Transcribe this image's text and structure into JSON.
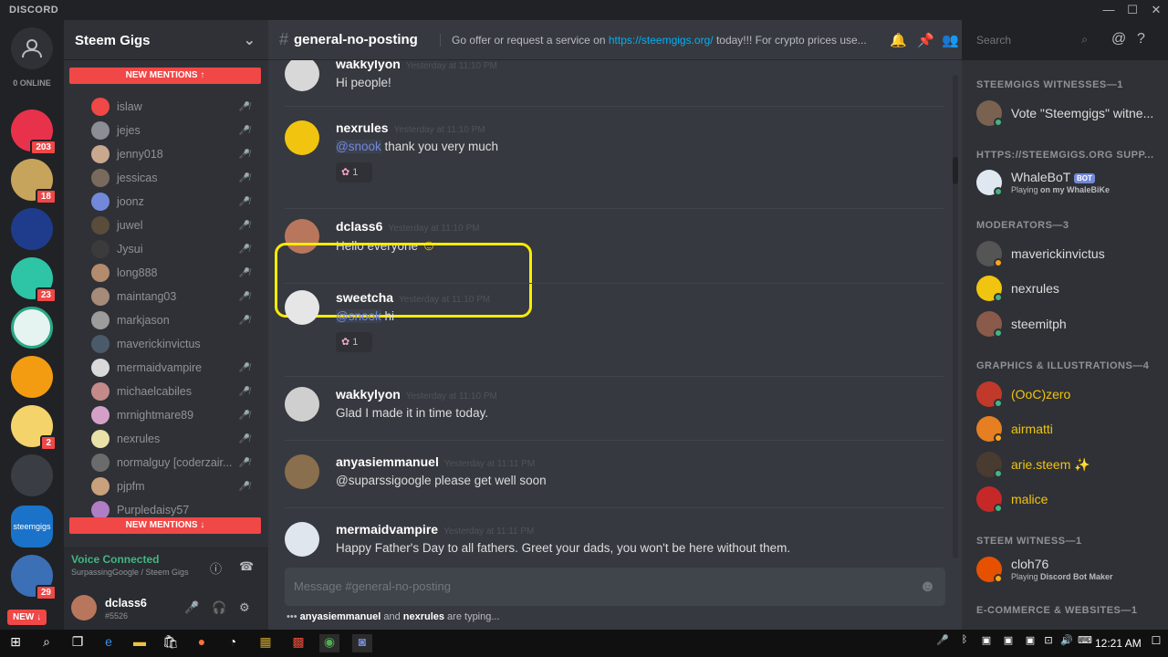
{
  "app": {
    "title": "DISCORD"
  },
  "guilds": {
    "online": "0 ONLINE",
    "items": [
      {
        "badge": "203"
      },
      {
        "badge": "18"
      },
      {
        "badge": ""
      },
      {
        "badge": "23"
      },
      {
        "badge": ""
      },
      {
        "badge": ""
      },
      {
        "badge": "2"
      },
      {
        "badge": ""
      },
      {
        "label": "steemgigs",
        "badge": ""
      },
      {
        "badge": "29"
      }
    ],
    "new_label": "NEW ↓"
  },
  "server": {
    "name": "Steem Gigs"
  },
  "voice": {
    "new_mentions_top": "NEW MENTIONS ↑",
    "new_mentions_bottom": "NEW MENTIONS ↓",
    "members": [
      "islaw",
      "jejes",
      "jenny018",
      "jessicas",
      "joonz",
      "juwel",
      "Jysui",
      "long888",
      "maintang03",
      "markjason",
      "maverickinvictus",
      "mermaidvampire",
      "michaelcabiles",
      "mrnightmare89",
      "nexrules",
      "normalguy [coderzair...",
      "pjpfm",
      "Purpledaisy57"
    ],
    "status": "Voice Connected",
    "location": "SurpassingGoogle / Steem Gigs"
  },
  "user": {
    "name": "dclass6",
    "tag": "#5526"
  },
  "channel": {
    "name": "general-no-posting",
    "topic_prefix": "Go offer or request a service on ",
    "topic_link": "https://steemgigs.org/",
    "topic_suffix": " today!!! For crypto prices use..."
  },
  "search": {
    "placeholder": "Search"
  },
  "messages": [
    {
      "author": "wakkylyon",
      "time": "Yesterday at 11:10 PM",
      "text": "Hi people!"
    },
    {
      "author": "nexrules",
      "time": "Yesterday at 11:10 PM",
      "mention": "@snook",
      "text": " thank you very much",
      "reaction_count": "1"
    },
    {
      "author": "dclass6",
      "time": "Yesterday at 11:10 PM",
      "text": "Hello everyone"
    },
    {
      "author": "sweetcha",
      "time": "Yesterday at 11:10 PM",
      "mention": "@snook",
      "text": " hi",
      "reaction_count": "1"
    },
    {
      "author": "wakkylyon",
      "time": "Yesterday at 11:10 PM",
      "text": "Glad I made it in time today."
    },
    {
      "author": "anyasiemmanuel",
      "time": "Yesterday at 11:11 PM",
      "text": "@suparssigoogle please get well soon"
    },
    {
      "author": "mermaidvampire",
      "time": "Yesterday at 11:11 PM",
      "text": "Happy Father's Day to all fathers. Greet your dads, you won't be here without them."
    }
  ],
  "composer": {
    "placeholder": "Message #general-no-posting"
  },
  "typing": {
    "user1": "anyasiemmanuel",
    "and": " and ",
    "user2": "nexrules",
    "suffix": " are typing..."
  },
  "members": {
    "groups": [
      {
        "title": "STEEMGIGS WITNESSES—1",
        "members": [
          {
            "name": "Vote \"Steemgigs\" witne..."
          }
        ]
      },
      {
        "title": "HTTPS://STEEMGIGS.ORG SUPP...",
        "members": [
          {
            "name": "WhaleBoT",
            "bot": "BOT",
            "playing": "Playing ",
            "game": "on my WhaleBiKe"
          }
        ]
      },
      {
        "title": "MODERATORS—3",
        "members": [
          {
            "name": "maverickinvictus"
          },
          {
            "name": "nexrules"
          },
          {
            "name": "steemitph"
          }
        ]
      },
      {
        "title": "GRAPHICS & ILLUSTRATIONS—4",
        "members": [
          {
            "name": "(OoC)zero"
          },
          {
            "name": "airmatti"
          },
          {
            "name": "arie.steem"
          },
          {
            "name": "malice"
          }
        ]
      },
      {
        "title": "STEEM WITNESS—1",
        "members": [
          {
            "name": "cloh76",
            "playing": "Playing ",
            "game": "Discord Bot Maker"
          }
        ]
      },
      {
        "title": "E-COMMERCE & WEBSITES—1",
        "members": []
      }
    ]
  },
  "taskbar": {
    "time": "12:21 AM"
  },
  "colors": {
    "accent": "#7289da",
    "online": "#43b581",
    "mention": "#f04747",
    "highlight": "#ffeb00",
    "graphics_role": "#f1c40f"
  }
}
